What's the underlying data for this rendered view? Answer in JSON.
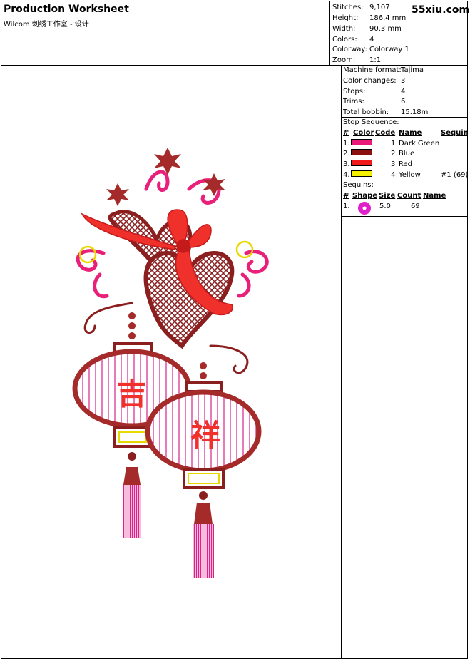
{
  "header": {
    "title": "Production Worksheet",
    "subtitle": "Wilcom 刺绣工作室 - 设计",
    "site": "55xiu.com"
  },
  "summary": [
    {
      "label": "Stitches:",
      "value": "9,107"
    },
    {
      "label": "Height:",
      "value": "186.4 mm"
    },
    {
      "label": "Width:",
      "value": "90.3 mm"
    },
    {
      "label": "Colors:",
      "value": "4"
    },
    {
      "label": "Colorway:",
      "value": "Colorway 1"
    },
    {
      "label": "Zoom:",
      "value": "1:1"
    }
  ],
  "machine": [
    {
      "label": "Machine format:",
      "value": "Tajima"
    },
    {
      "label": "Color changes:",
      "value": "3"
    },
    {
      "label": "Stops:",
      "value": "4"
    },
    {
      "label": "Trims:",
      "value": "6"
    },
    {
      "label": "Total bobbin:",
      "value": "15.18m"
    }
  ],
  "stop_sequence": {
    "title": "Stop Sequence:",
    "headers": {
      "num": "#",
      "color": "Color",
      "code": "Code",
      "name": "Name",
      "sequins": "Sequin"
    },
    "rows": [
      {
        "num": "1.",
        "color": "#e8197a",
        "code": "1",
        "name": "Dark Green",
        "sequins": ""
      },
      {
        "num": "2.",
        "color": "#8b1010",
        "code": "2",
        "name": "Blue",
        "sequins": ""
      },
      {
        "num": "3.",
        "color": "#f01a1a",
        "code": "3",
        "name": "Red",
        "sequins": ""
      },
      {
        "num": "4.",
        "color": "#f5ef00",
        "code": "4",
        "name": "Yellow",
        "sequins": "#1 (69)"
      }
    ]
  },
  "sequins": {
    "title": "Sequins:",
    "headers": {
      "num": "#",
      "shape": "Shape",
      "size": "Size",
      "count": "Count",
      "name": "Name"
    },
    "rows": [
      {
        "num": "1.",
        "shape_color": "#e020c8",
        "size": "5.0",
        "count": "69",
        "name": ""
      }
    ]
  }
}
